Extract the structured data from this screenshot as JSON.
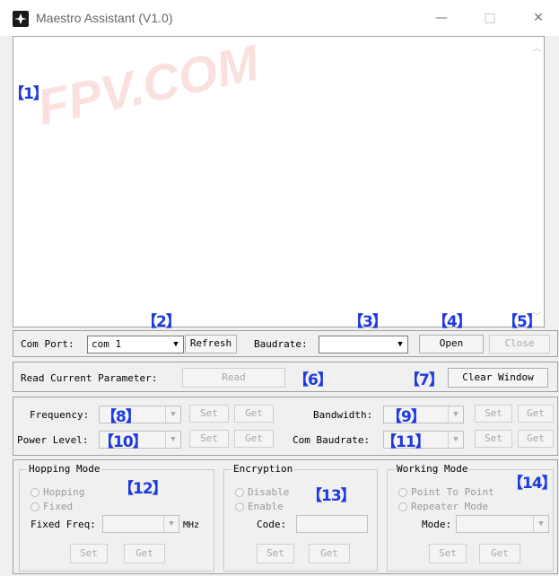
{
  "window": {
    "title": "Maestro Assistant (V1.0)",
    "controls": {
      "minimize": "—",
      "maximize": "□",
      "close": "✕"
    }
  },
  "watermark": "FPV.COM",
  "markers": [
    "【1】",
    "【2】",
    "【3】",
    "【4】",
    "【5】",
    "【6】",
    "【7】",
    "【8】",
    "【9】",
    "【10】",
    "【11】",
    "【12】",
    "【13】",
    "【14】"
  ],
  "com_row": {
    "com_port_label": "Com Port:",
    "com_port_value": "com 1",
    "refresh_label": "Refresh",
    "baudrate_label": "Baudrate:",
    "baudrate_value": "",
    "open_label": "Open",
    "close_label": "Close"
  },
  "read_row": {
    "label": "Read Current Parameter:",
    "read_label": "Read",
    "clear_label": "Clear Window"
  },
  "params": {
    "frequency_label": "Frequency:",
    "power_label": "Power Level:",
    "bandwidth_label": "Bandwidth:",
    "com_baud_label": "Com Baudrate:",
    "set_label": "Set",
    "get_label": "Get"
  },
  "hopping": {
    "title": "Hopping Mode",
    "opt1": "Hopping",
    "opt2": "Fixed",
    "fixed_freq_label": "Fixed Freq:",
    "unit": "MHz",
    "set_label": "Set",
    "get_label": "Get"
  },
  "encryption": {
    "title": "Encryption",
    "opt1": "Disable",
    "opt2": "Enable",
    "code_label": "Code:",
    "set_label": "Set",
    "get_label": "Get"
  },
  "working": {
    "title": "Working Mode",
    "opt1": "Point To Point",
    "opt2": "Repeater Mode",
    "mode_label": "Mode:",
    "set_label": "Set",
    "get_label": "Get"
  },
  "colors": {
    "marker": "#1d39e0",
    "watermark": "#e6786e"
  }
}
